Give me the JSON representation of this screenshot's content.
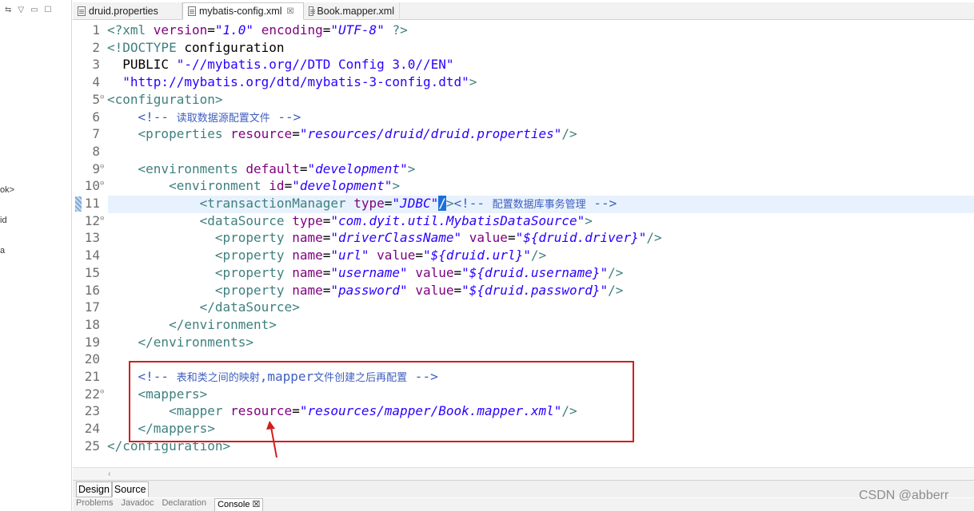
{
  "left_pane": {
    "toolbar_icons": [
      "sync-icon",
      "view-menu-icon",
      "minimize-icon",
      "maximize-icon"
    ],
    "fragments": [
      "ok>",
      "id",
      "a"
    ]
  },
  "tabs": [
    {
      "label": "druid.properties",
      "active": false,
      "closable": false
    },
    {
      "label": "mybatis-config.xml",
      "active": true,
      "closable": true,
      "close_glyph": "☒"
    },
    {
      "label": "Book.mapper.xml",
      "active": false,
      "closable": false
    }
  ],
  "code_lines": [
    {
      "n": "1",
      "fold": "",
      "tokens": [
        {
          "t": "t",
          "s": "<?xml "
        },
        {
          "t": "a",
          "s": "version"
        },
        {
          "t": "code",
          "s": "="
        },
        {
          "t": "v",
          "s": "\"1.0\""
        },
        {
          "t": "code",
          "s": " "
        },
        {
          "t": "a",
          "s": "encoding"
        },
        {
          "t": "code",
          "s": "="
        },
        {
          "t": "v",
          "s": "\"UTF-8\""
        },
        {
          "t": "t",
          "s": " ?>"
        }
      ]
    },
    {
      "n": "2",
      "fold": "",
      "tokens": [
        {
          "t": "t",
          "s": "<!DOCTYPE "
        },
        {
          "t": "code",
          "s": "configuration"
        }
      ]
    },
    {
      "n": "3",
      "fold": "",
      "tokens": [
        {
          "t": "code",
          "s": "  PUBLIC "
        },
        {
          "t": "v2",
          "s": "\"-//mybatis.org//DTD Config 3.0//EN\""
        }
      ]
    },
    {
      "n": "4",
      "fold": "",
      "tokens": [
        {
          "t": "v2",
          "s": "  \"http://mybatis.org/dtd/mybatis-3-config.dtd\""
        },
        {
          "t": "t",
          "s": ">"
        }
      ]
    },
    {
      "n": "5",
      "fold": "⊖",
      "tokens": [
        {
          "t": "t",
          "s": "<configuration>"
        }
      ]
    },
    {
      "n": "6",
      "fold": "",
      "tokens": [
        {
          "t": "c",
          "s": "    <!-- "
        },
        {
          "t": "cs",
          "s": "读取数据源配置文件"
        },
        {
          "t": "c",
          "s": " -->"
        }
      ]
    },
    {
      "n": "7",
      "fold": "",
      "tokens": [
        {
          "t": "t",
          "s": "    <properties "
        },
        {
          "t": "a",
          "s": "resource"
        },
        {
          "t": "code",
          "s": "="
        },
        {
          "t": "v",
          "s": "\"resources/druid/druid.properties\""
        },
        {
          "t": "t",
          "s": "/>"
        }
      ]
    },
    {
      "n": "8",
      "fold": "",
      "tokens": []
    },
    {
      "n": "9",
      "fold": "⊖",
      "tokens": [
        {
          "t": "t",
          "s": "    <environments "
        },
        {
          "t": "a",
          "s": "default"
        },
        {
          "t": "code",
          "s": "="
        },
        {
          "t": "v",
          "s": "\"development\""
        },
        {
          "t": "t",
          "s": ">"
        }
      ]
    },
    {
      "n": "10",
      "fold": "⊖",
      "tokens": [
        {
          "t": "t",
          "s": "        <environment "
        },
        {
          "t": "a",
          "s": "id"
        },
        {
          "t": "code",
          "s": "="
        },
        {
          "t": "v",
          "s": "\"development\""
        },
        {
          "t": "t",
          "s": ">"
        }
      ]
    },
    {
      "n": "11",
      "fold": "",
      "tokens": [
        {
          "t": "t",
          "s": "            <transactionManager "
        },
        {
          "t": "a",
          "s": "type"
        },
        {
          "t": "code",
          "s": "="
        },
        {
          "t": "v",
          "s": "\"JDBC\""
        },
        {
          "t": "sel",
          "s": "/"
        },
        {
          "t": "t",
          "s": ">"
        },
        {
          "t": "c",
          "s": "<!-- "
        },
        {
          "t": "cs",
          "s": "配置数据库事务管理"
        },
        {
          "t": "c",
          "s": " -->"
        }
      ]
    },
    {
      "n": "12",
      "fold": "⊖",
      "tokens": [
        {
          "t": "t",
          "s": "            <dataSource "
        },
        {
          "t": "a",
          "s": "type"
        },
        {
          "t": "code",
          "s": "="
        },
        {
          "t": "v",
          "s": "\"com.dyit.util.MybatisDataSource\""
        },
        {
          "t": "t",
          "s": ">"
        }
      ]
    },
    {
      "n": "13",
      "fold": "",
      "tokens": [
        {
          "t": "t",
          "s": "              <property "
        },
        {
          "t": "a",
          "s": "name"
        },
        {
          "t": "code",
          "s": "="
        },
        {
          "t": "v",
          "s": "\"driverClassName\""
        },
        {
          "t": "code",
          "s": " "
        },
        {
          "t": "a",
          "s": "value"
        },
        {
          "t": "code",
          "s": "="
        },
        {
          "t": "v",
          "s": "\"${druid.driver}\""
        },
        {
          "t": "t",
          "s": "/>"
        }
      ]
    },
    {
      "n": "14",
      "fold": "",
      "tokens": [
        {
          "t": "t",
          "s": "              <property "
        },
        {
          "t": "a",
          "s": "name"
        },
        {
          "t": "code",
          "s": "="
        },
        {
          "t": "v",
          "s": "\"url\""
        },
        {
          "t": "code",
          "s": " "
        },
        {
          "t": "a",
          "s": "value"
        },
        {
          "t": "code",
          "s": "="
        },
        {
          "t": "v",
          "s": "\"${druid.url}\""
        },
        {
          "t": "t",
          "s": "/>"
        }
      ]
    },
    {
      "n": "15",
      "fold": "",
      "tokens": [
        {
          "t": "t",
          "s": "              <property "
        },
        {
          "t": "a",
          "s": "name"
        },
        {
          "t": "code",
          "s": "="
        },
        {
          "t": "v",
          "s": "\"username\""
        },
        {
          "t": "code",
          "s": " "
        },
        {
          "t": "a",
          "s": "value"
        },
        {
          "t": "code",
          "s": "="
        },
        {
          "t": "v",
          "s": "\"${druid.username}\""
        },
        {
          "t": "t",
          "s": "/>"
        }
      ]
    },
    {
      "n": "16",
      "fold": "",
      "tokens": [
        {
          "t": "t",
          "s": "              <property "
        },
        {
          "t": "a",
          "s": "name"
        },
        {
          "t": "code",
          "s": "="
        },
        {
          "t": "v",
          "s": "\"password\""
        },
        {
          "t": "code",
          "s": " "
        },
        {
          "t": "a",
          "s": "value"
        },
        {
          "t": "code",
          "s": "="
        },
        {
          "t": "v",
          "s": "\"${druid.password}\""
        },
        {
          "t": "t",
          "s": "/>"
        }
      ]
    },
    {
      "n": "17",
      "fold": "",
      "tokens": [
        {
          "t": "t",
          "s": "            </dataSource>"
        }
      ]
    },
    {
      "n": "18",
      "fold": "",
      "tokens": [
        {
          "t": "t",
          "s": "        </environment>"
        }
      ]
    },
    {
      "n": "19",
      "fold": "",
      "tokens": [
        {
          "t": "t",
          "s": "    </environments>"
        }
      ]
    },
    {
      "n": "20",
      "fold": "",
      "tokens": []
    },
    {
      "n": "21",
      "fold": "",
      "tokens": [
        {
          "t": "c",
          "s": "    <!-- "
        },
        {
          "t": "cs",
          "s": "表和类之间的映射"
        },
        {
          "t": "c",
          "s": ","
        },
        {
          "t": "c",
          "s": "mapper"
        },
        {
          "t": "cs",
          "s": "文件创建之后再配置"
        },
        {
          "t": "c",
          "s": " -->"
        }
      ]
    },
    {
      "n": "22",
      "fold": "⊖",
      "tokens": [
        {
          "t": "t",
          "s": "    <mappers>"
        }
      ]
    },
    {
      "n": "23",
      "fold": "",
      "tokens": [
        {
          "t": "t",
          "s": "        <mapper "
        },
        {
          "t": "a",
          "s": "resource"
        },
        {
          "t": "code",
          "s": "="
        },
        {
          "t": "v",
          "s": "\"resources/mapper/Book.mapper.xml\""
        },
        {
          "t": "t",
          "s": "/>"
        }
      ]
    },
    {
      "n": "24",
      "fold": "",
      "tokens": [
        {
          "t": "t",
          "s": "    </mappers>"
        }
      ]
    },
    {
      "n": "25",
      "fold": "",
      "tokens": [
        {
          "t": "t",
          "s": "</configuration>"
        }
      ]
    }
  ],
  "design_source_tabs": {
    "design": "Design",
    "source": "Source",
    "active": "Source"
  },
  "views_bar": [
    "Problems",
    "Javadoc",
    "Declaration",
    "Console ☒"
  ],
  "watermark": "CSDN @abberr",
  "colors": {
    "tag": "#3f7f7f",
    "attr": "#7f007f",
    "value": "#2a00ff",
    "comment": "#3f5fbf",
    "highlight_box": "#d21d1d",
    "current_line": "#e8f2fe"
  }
}
